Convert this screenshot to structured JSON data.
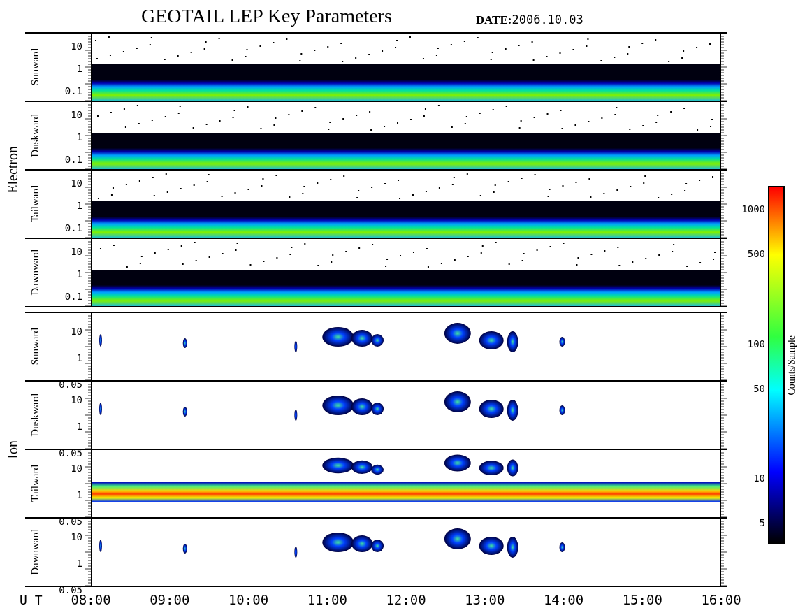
{
  "title": "GEOTAIL LEP Key Parameters",
  "date": {
    "label": "DATE:",
    "value": "2006.10.03"
  },
  "groups": [
    {
      "name": "Electron",
      "panels": [
        {
          "label": "Sunward",
          "kind": "band",
          "ticks": [
            "10",
            "1",
            "0.1"
          ]
        },
        {
          "label": "Duskward",
          "kind": "band",
          "ticks": [
            "10",
            "1",
            "0.1"
          ]
        },
        {
          "label": "Tailward",
          "kind": "band",
          "ticks": [
            "10",
            "1",
            "0.1"
          ]
        },
        {
          "label": "Dawnward",
          "kind": "band",
          "ticks": [
            "10",
            "1",
            "0.1"
          ]
        }
      ]
    },
    {
      "name": "Ion",
      "panels": [
        {
          "label": "Sunward",
          "kind": "blobs",
          "ticks": [
            "10",
            "1",
            "0.05"
          ]
        },
        {
          "label": "Duskward",
          "kind": "blobs",
          "ticks": [
            "10",
            "1",
            "0.05"
          ]
        },
        {
          "label": "Tailward",
          "kind": "beam",
          "ticks": [
            "10",
            "1",
            "0.05"
          ]
        },
        {
          "label": "Dawnward",
          "kind": "blobs",
          "ticks": [
            "10",
            "1",
            "0.05"
          ]
        }
      ]
    }
  ],
  "colorbar": {
    "title": "Counts/Sample",
    "ticks": [
      "1000",
      "500",
      "100",
      "50",
      "10",
      "5"
    ]
  },
  "time_axis": {
    "label": "U T",
    "ticks": [
      "08:00",
      "09:00",
      "10:00",
      "11:00",
      "12:00",
      "13:00",
      "14:00",
      "15:00",
      "16:00"
    ]
  }
}
